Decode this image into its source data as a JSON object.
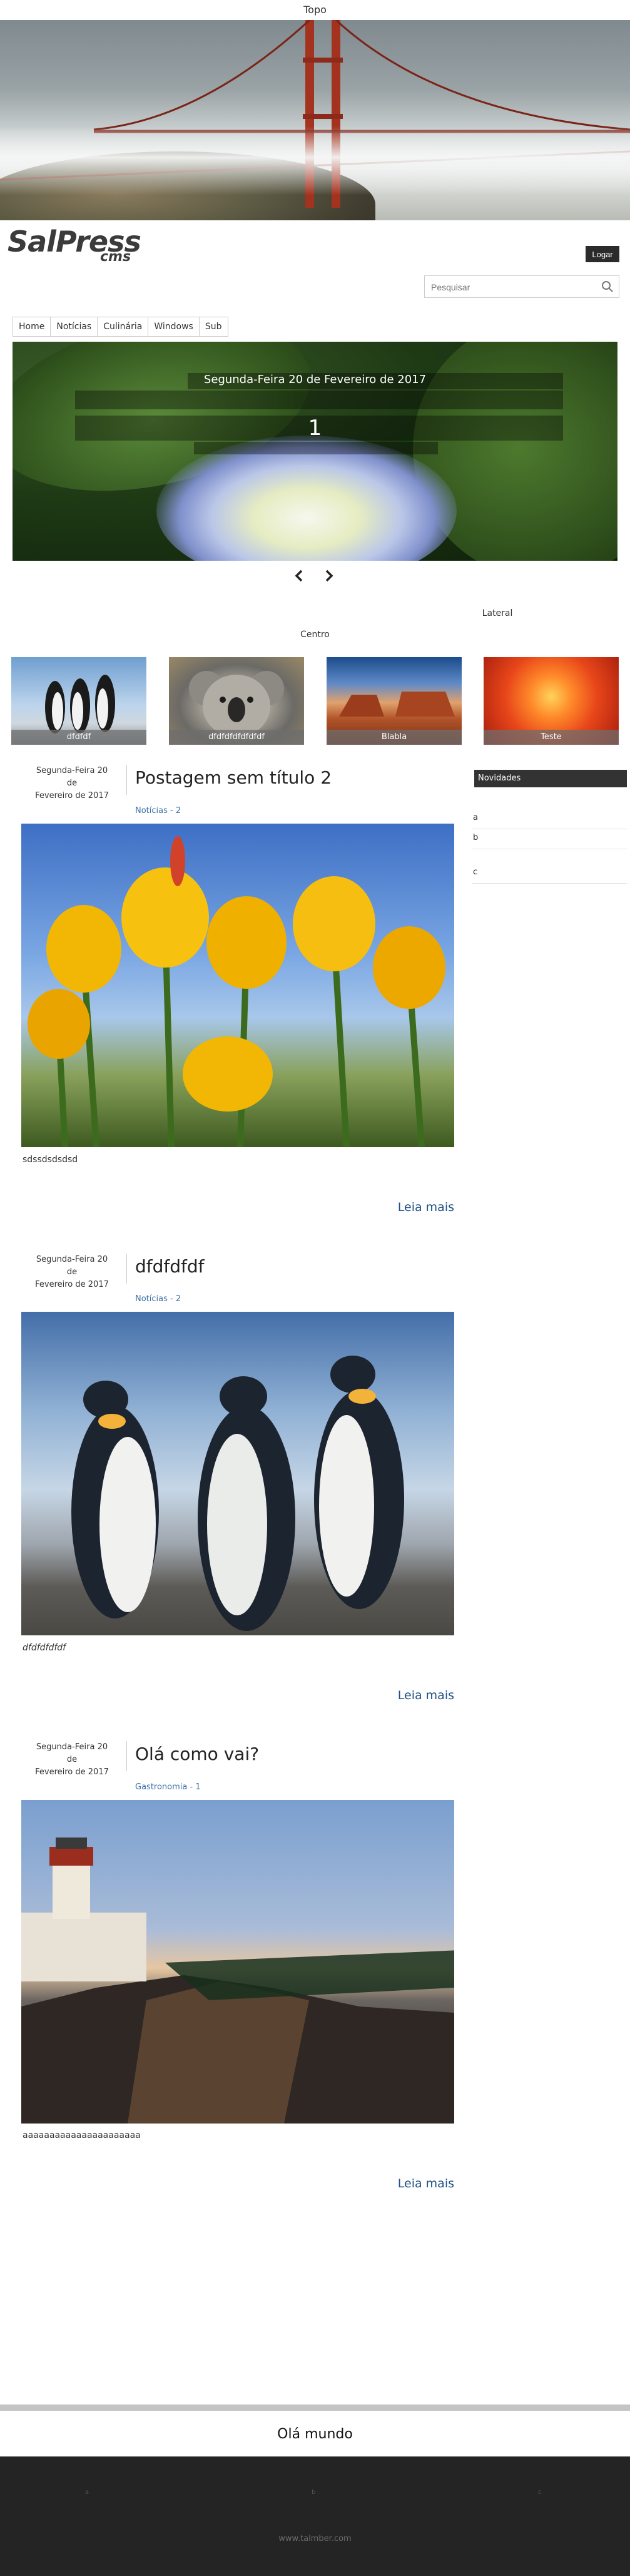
{
  "top_label": "Topo",
  "logo": {
    "main": "SalPress",
    "sub": "cms"
  },
  "login_label": "Logar",
  "search": {
    "placeholder": "Pesquisar"
  },
  "nav": [
    "Home",
    "Notícias",
    "Culinária",
    "Windows",
    "Sub"
  ],
  "slider": {
    "date": "Segunda-Feira 20 de Fevereiro de 2017",
    "number": "1"
  },
  "lateral_label": "Lateral",
  "centro_label": "Centro",
  "thumbnails": [
    "dfdfdf",
    "dfdfdfdfdfdfdf",
    "Blabla",
    "Teste"
  ],
  "sidebar": {
    "heading": "Novidades",
    "items": [
      "a",
      "b",
      "c"
    ]
  },
  "posts": [
    {
      "date_line1": "Segunda-Feira 20 de",
      "date_line2": "Fevereiro de 2017",
      "title": "Postagem sem título 2",
      "category": "Notícias - 2",
      "excerpt": "sdssdsdsdsd",
      "more": "Leia mais"
    },
    {
      "date_line1": "Segunda-Feira 20 de",
      "date_line2": "Fevereiro de 2017",
      "title": "dfdfdfdf",
      "category": "Notícias - 2",
      "excerpt": "dfdfdfdfdf",
      "more": "Leia mais"
    },
    {
      "date_line1": "Segunda-Feira 20 de",
      "date_line2": "Fevereiro de 2017",
      "title": "Olá como vai?",
      "category": "Gastronomia - 1",
      "excerpt": "aaaaaaaaaaaaaaaaaaaaaa",
      "more": "Leia mais"
    }
  ],
  "footer": {
    "title": "Olá mundo",
    "dots": [
      "a",
      "b",
      "c"
    ],
    "link": "www.talmber.com"
  }
}
